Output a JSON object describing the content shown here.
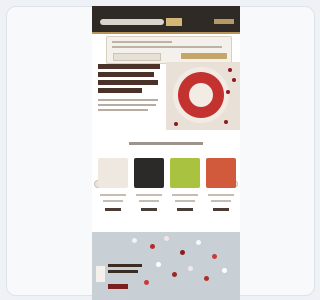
{
  "colors": {
    "page_bg": "#eef1f5",
    "header_bg": "#2f2a26",
    "accent_gold": "#c4a56a",
    "brand_red": "#c3322f",
    "banner_bg": "#c8cfd5"
  },
  "icons": [
    "search-icon",
    "logo-icon",
    "account-icon",
    "cart-icon",
    "chevron-left-icon",
    "chevron-right-icon"
  ]
}
